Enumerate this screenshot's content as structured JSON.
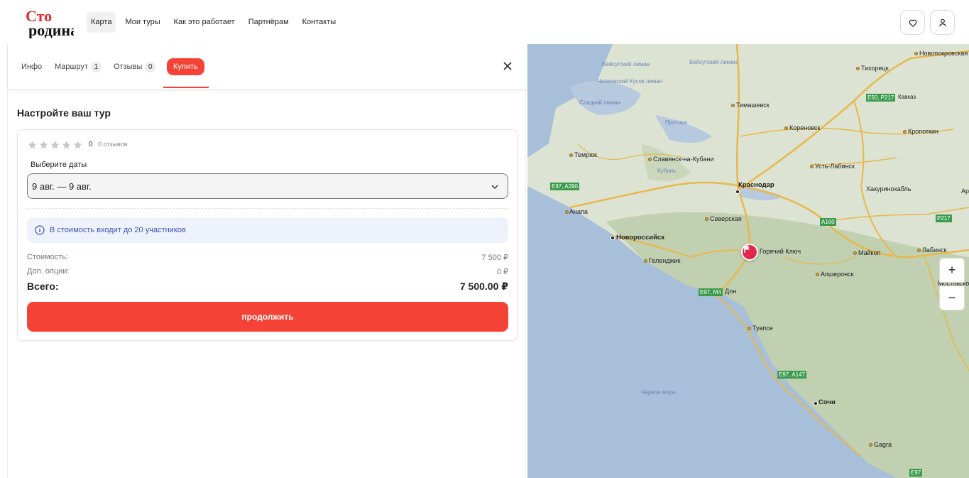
{
  "header": {
    "logo_text": "Сто родина",
    "nav": [
      "Карта",
      "Мои туры",
      "Как это работает",
      "Партнёрам",
      "Контакты"
    ]
  },
  "tabs": {
    "info": "Инфо",
    "route": "Маршрут",
    "route_count": "1",
    "reviews": "Отзывы",
    "reviews_count": "0",
    "buy": "Купить"
  },
  "booking": {
    "title": "Настройте ваш тур",
    "rating_value": "0",
    "rating_count": "0 отзывов",
    "date_label": "Выберите даты",
    "date_value": "9 авг. — 9 авг.",
    "info_text": "В стоимость входит до 20 участников",
    "cost_label": "Стоимость:",
    "cost_value": "7 500 ₽",
    "options_label": "Доп. опции:",
    "options_value": "0 ₽",
    "total_label": "Всего:",
    "total_value": "7 500.00 ₽",
    "cta": "продолжить"
  },
  "map": {
    "zoom_in": "+",
    "zoom_out": "−",
    "labels": {
      "novopokrovskaya": "Новопокровская",
      "tikhoretsk": "Тихорецк",
      "kavkaz": "Кавказ",
      "timashevsk": "Тимашевск",
      "korenovsk": "Кореновск",
      "kropotkin": "Кропоткин",
      "temryuk": "Темрюк",
      "slavyansk": "Славянск-на-Кубани",
      "ust_labinsk": "Усть-Лабинск",
      "krasnodar": "Краснодар",
      "khakurinokhabl": "Хакуринохабль",
      "ap": "Ар",
      "anapa": "Анапа",
      "severskaya": "Северская",
      "novorossiysk": "Новороссийск",
      "goryachiy_klyuch": "Горячий Ключ",
      "maykop": "Майкоп",
      "labinsk": "Лабинск",
      "gelendzhik": "Геленджик",
      "apsheronsk": "Апшеронск",
      "mostovskoy": "Мостовско",
      "don": "Дон",
      "tuapse": "Туапсе",
      "sochi": "Сочи",
      "gagra": "Gagra",
      "black_sea": "Черное море",
      "beisug": "Бейсугский лиман",
      "beisug2": "Бейсугский лиман",
      "chelbas": "Челиевский Кусок лиман",
      "kurchanskiy": "Сладкий лиман",
      "protoka": "Протока",
      "kuban": "Кубань"
    },
    "shields": {
      "e50": "E50, P217",
      "e97_a290": "E97, A290",
      "a160": "A160",
      "p217": "P217",
      "e97_m4": "E97, M4",
      "e97_a147": "E97, A147",
      "e97": "E97"
    },
    "colors": {
      "land": "#dce3d3",
      "sea": "#a8bfd9",
      "forest": "#b8c9a4",
      "road": "#e8b84a",
      "marker": "#e0264d"
    }
  }
}
